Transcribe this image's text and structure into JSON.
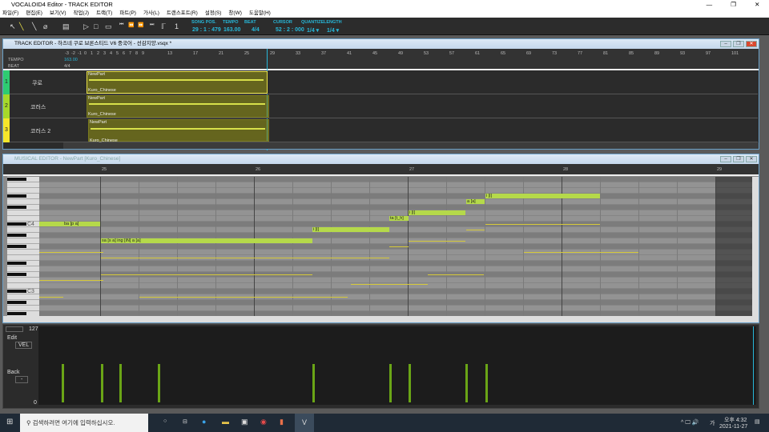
{
  "app": {
    "title": "VOCALOID4 Editor - TRACK EDITOR"
  },
  "menu": [
    "파일(F)",
    "편집(E)",
    "보기(V)",
    "작업(J)",
    "트랙(T)",
    "파트(P)",
    "가사(L)",
    "트랜스포트(R)",
    "설정(S)",
    "창(W)",
    "도움말(H)"
  ],
  "toolbar": {
    "song_pos_label": "SONG POS.",
    "song_pos": "29 : 1 : 479",
    "tempo_label": "TEMPO",
    "tempo": "163.00",
    "beat_label": "BEAT",
    "beat": "4/4",
    "cursor_label": "CURSOR",
    "cursor": "52 : 2 : 000",
    "quantize_label": "QUANTIZE",
    "quantize": "1/4 ▾",
    "length_label": "LENGTH",
    "length": "1/4 ▾"
  },
  "track_editor": {
    "title": "TRACK EDITOR - 하즈네 쿠로 브론스티드 V6 중국어 - 선감지양.vsqx *",
    "tempo_label": "TEMPO",
    "beat_label": "BEAT",
    "tempo_value": "163.00",
    "beat_value": "4/4",
    "ruler": [
      "-3",
      "-2",
      "-1",
      "0",
      "1",
      "2",
      "3",
      "4",
      "5",
      "6",
      "7",
      "8",
      "9",
      "13",
      "17",
      "21",
      "25",
      "29",
      "33",
      "37",
      "41",
      "45",
      "49",
      "53",
      "57",
      "61",
      "65",
      "69",
      "73",
      "77",
      "81",
      "85",
      "89",
      "93",
      "97",
      "101"
    ],
    "tracks": [
      {
        "num": "1",
        "name": "쿠로",
        "color": "#2ecc71",
        "part": "NewPart",
        "singer": "Kuro_Chinese"
      },
      {
        "num": "2",
        "name": "코러스",
        "color": "#a6d82a",
        "part": "NewPart",
        "singer": "Kuro_Chinese"
      },
      {
        "num": "3",
        "name": "코러스 2",
        "color": "#f5e62a",
        "part": "NewPart",
        "singer": "Kuro_Chinese"
      }
    ]
  },
  "musical_editor": {
    "title": "MUSICAL EDITOR - NewPart [Kuro_Chinese]",
    "measures": [
      "25",
      "26",
      "27",
      "28",
      "29"
    ],
    "key_labels": [
      "C4",
      "C3"
    ],
    "notes": [
      {
        "lyric": "ba [p a]"
      },
      {
        "lyric": "sa [s a]  ing [iN]  a [a]"
      },
      {
        "lyric": "i [i]"
      },
      {
        "lyric": "ta [t_h]"
      },
      {
        "lyric": "i [i]"
      },
      {
        "lyric": "a [a]"
      },
      {
        "lyric": "i [i]"
      }
    ],
    "control": {
      "max": "127",
      "min": "0",
      "edit_label": "Edit",
      "edit_value": "VEL",
      "back_label": "Back",
      "back_value": "-"
    },
    "velocities": [
      64,
      64,
      64,
      64,
      64,
      64,
      64,
      64,
      64
    ]
  },
  "taskbar": {
    "search_placeholder": "검색하려면 여기에 입력하십시오.",
    "time": "오후 4:32",
    "date": "2021-11-27",
    "ime": "가"
  }
}
